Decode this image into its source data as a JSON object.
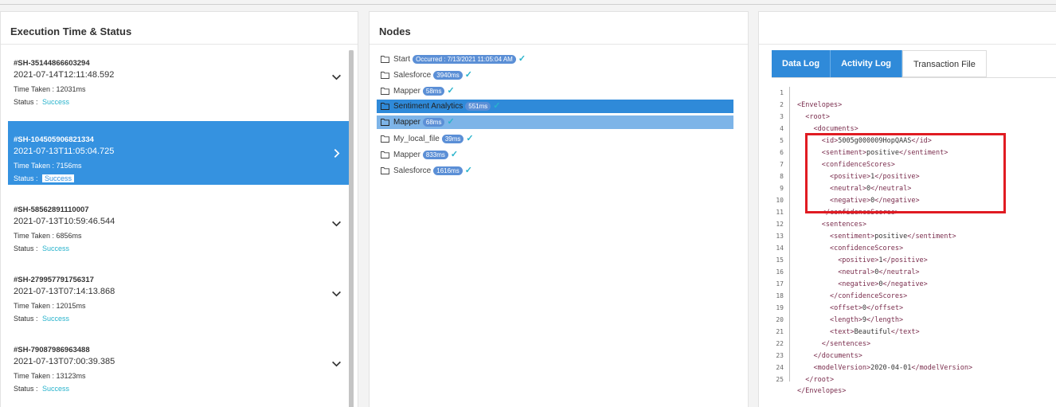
{
  "exec_panel": {
    "title": "Execution Time & Status",
    "taken_label": "Time Taken : ",
    "status_label": "Status : ",
    "items": [
      {
        "id": "#SH-35144866603294",
        "time": "2021-07-14T12:11:48.592",
        "taken": "12031ms",
        "status": "Success",
        "active": false
      },
      {
        "id": "#SH-104505906821334",
        "time": "2021-07-13T11:05:04.725",
        "taken": "7156ms",
        "status": "Success",
        "active": true
      },
      {
        "id": "#SH-58562891110007",
        "time": "2021-07-13T10:59:46.544",
        "taken": "6856ms",
        "status": "Success",
        "active": false
      },
      {
        "id": "#SH-279957791756317",
        "time": "2021-07-13T07:14:13.868",
        "taken": "12015ms",
        "status": "Success",
        "active": false
      },
      {
        "id": "#SH-79087986963488",
        "time": "2021-07-13T07:00:39.385",
        "taken": "13123ms",
        "status": "Success",
        "active": false
      }
    ]
  },
  "nodes_panel": {
    "title": "Nodes",
    "items": [
      {
        "label": "Start",
        "badge": "Occurred : 7/13/2021 11:05:04 AM"
      },
      {
        "label": "Salesforce",
        "badge": "3940ms"
      },
      {
        "label": "Mapper",
        "badge": "58ms"
      },
      {
        "label": "Sentiment Analytics",
        "badge": "551ms"
      },
      {
        "label": "Mapper",
        "badge": "68ms"
      },
      {
        "label": "My_local_file",
        "badge": "39ms"
      },
      {
        "label": "Mapper",
        "badge": "833ms"
      },
      {
        "label": "Salesforce",
        "badge": "1616ms"
      }
    ]
  },
  "log_panel": {
    "tabs": [
      "Data Log",
      "Activity Log",
      "Transaction File"
    ],
    "lines": [
      {
        "n": "1",
        "text": ""
      },
      {
        "n": "2",
        "text": "<Envelopes>"
      },
      {
        "n": "3",
        "text": "  <root>"
      },
      {
        "n": "4",
        "text": "    <documents>"
      },
      {
        "n": "5",
        "text": "      <id>5005g000009HopQAAS</id>"
      },
      {
        "n": "6",
        "text": "      <sentiment>positive</sentiment>"
      },
      {
        "n": "7",
        "text": "      <confidenceScores>"
      },
      {
        "n": "8",
        "text": "        <positive>1</positive>"
      },
      {
        "n": "9",
        "text": "        <neutral>0</neutral>"
      },
      {
        "n": "10",
        "text": "        <negative>0</negative>"
      },
      {
        "n": "11",
        "text": "      </confidenceScores>"
      },
      {
        "n": "12",
        "text": "      <sentences>"
      },
      {
        "n": "13",
        "text": "        <sentiment>positive</sentiment>"
      },
      {
        "n": "14",
        "text": "        <confidenceScores>"
      },
      {
        "n": "15",
        "text": "          <positive>1</positive>"
      },
      {
        "n": "16",
        "text": "          <neutral>0</neutral>"
      },
      {
        "n": "17",
        "text": "          <negative>0</negative>"
      },
      {
        "n": "18",
        "text": "        </confidenceScores>"
      },
      {
        "n": "19",
        "text": "        <offset>0</offset>"
      },
      {
        "n": "20",
        "text": "        <length>9</length>"
      },
      {
        "n": "21",
        "text": "        <text>Beautiful</text>"
      },
      {
        "n": "22",
        "text": "      </sentences>"
      },
      {
        "n": "23",
        "text": "    </documents>"
      },
      {
        "n": "24",
        "text": "    <modelVersion>2020-04-01</modelVersion>"
      },
      {
        "n": "25",
        "text": "  </root>"
      },
      {
        "n": "",
        "text": "</Envelopes>"
      }
    ]
  },
  "colors": {
    "accent": "#3592e0",
    "success": "#28b3cc",
    "highlight": "#e01b22",
    "xml_tag": "#7a2d4d"
  },
  "icons": {
    "node": "folder-icon",
    "expand": "chevron-down-icon",
    "active": "chevron-right-icon",
    "done": "check-icon"
  }
}
